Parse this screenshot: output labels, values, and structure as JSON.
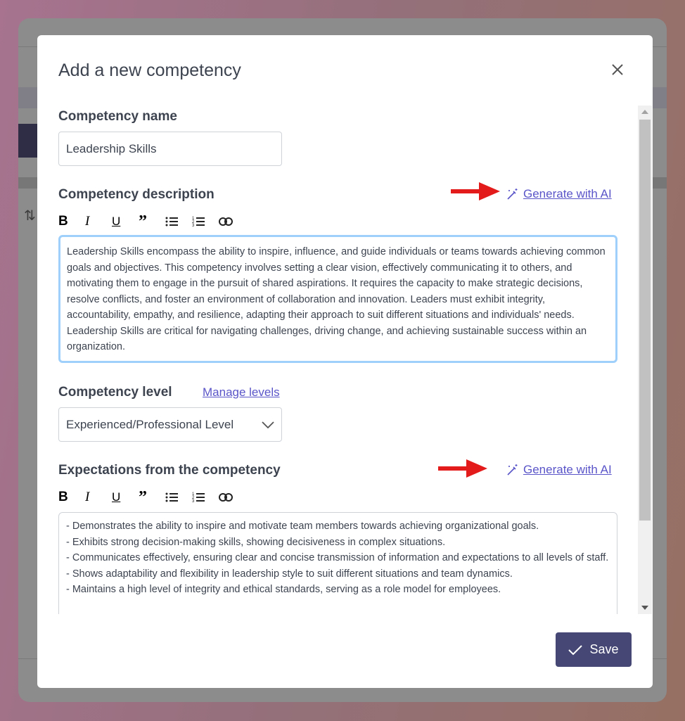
{
  "modal": {
    "title": "Add a new competency",
    "close_icon": "close-icon",
    "name_label": "Competency name",
    "name_value": "Leadership Skills",
    "description_label": "Competency description",
    "generate_ai_label": "Generate with AI",
    "toolbar": [
      "bold",
      "italic",
      "underline",
      "quote",
      "bullet-list",
      "numbered-list",
      "link"
    ],
    "description_text": "Leadership Skills encompass the ability to inspire, influence, and guide individuals or teams towards achieving common goals and objectives. This competency involves setting a clear vision, effectively communicating it to others, and motivating them to engage in the pursuit of shared aspirations. It requires the capacity to make strategic decisions, resolve conflicts, and foster an environment of collaboration and innovation. Leaders must exhibit integrity, accountability, empathy, and resilience, adapting their approach to suit different situations and individuals' needs. Leadership Skills are critical for navigating challenges, driving change, and achieving sustainable success within an organization.",
    "level_label": "Competency level",
    "manage_levels_label": "Manage levels",
    "level_value": "Experienced/Professional Level",
    "expectations_label": "Expectations from the competency",
    "expectations": [
      "- Demonstrates the ability to inspire and motivate team members towards achieving organizational goals.",
      "- Exhibits strong decision-making skills, showing decisiveness in complex situations.",
      "- Communicates effectively, ensuring clear and concise transmission of information and expectations to all levels of staff.",
      "- Shows adaptability and flexibility in leadership style to suit different situations and team dynamics.",
      "- Maintains a high level of integrity and ethical standards, serving as a role model for employees."
    ],
    "save_label": "Save"
  },
  "colors": {
    "accent": "#464774",
    "link": "#5a55c8",
    "focus_border": "#9fd0fb",
    "annotation_arrow": "#e31b1b"
  }
}
